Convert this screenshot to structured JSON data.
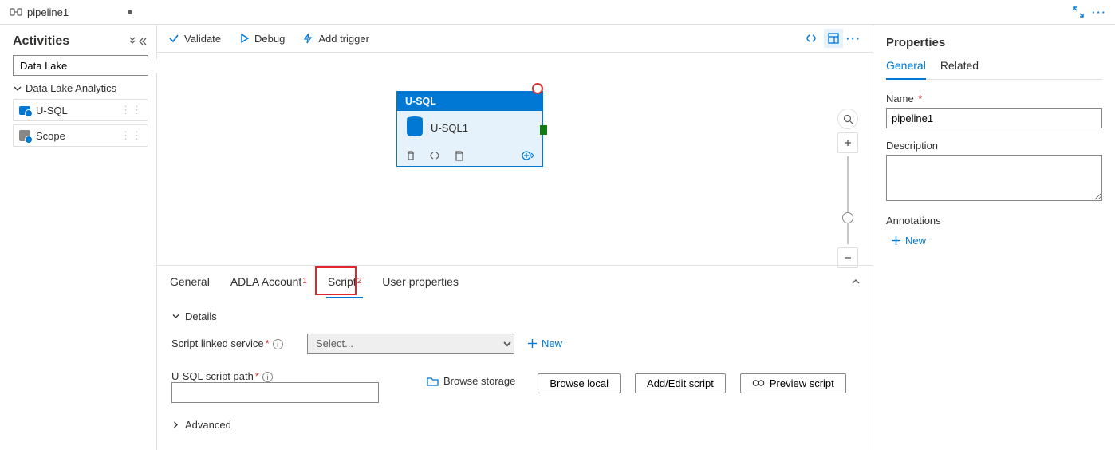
{
  "tab": {
    "name": "pipeline1"
  },
  "activities": {
    "title": "Activities",
    "search_placeholder": "Data Lake",
    "group": "Data Lake Analytics",
    "items": [
      {
        "label": "U-SQL"
      },
      {
        "label": "Scope"
      }
    ]
  },
  "toolbar": {
    "validate": "Validate",
    "debug": "Debug",
    "add_trigger": "Add trigger"
  },
  "canvas": {
    "node_type": "U-SQL",
    "node_name": "U-SQL1"
  },
  "bottom": {
    "tabs": {
      "general": "General",
      "adla": "ADLA Account",
      "script": "Script",
      "user_props": "User properties"
    },
    "details": "Details",
    "linked_service_label": "Script linked service",
    "linked_service_placeholder": "Select...",
    "new_label": "New",
    "script_path_label": "U-SQL script path",
    "browse_storage": "Browse storage",
    "browse_local": "Browse local",
    "add_edit_script": "Add/Edit script",
    "preview_script": "Preview script",
    "advanced": "Advanced"
  },
  "properties": {
    "title": "Properties",
    "tab_general": "General",
    "tab_related": "Related",
    "name_label": "Name",
    "name_value": "pipeline1",
    "desc_label": "Description",
    "annotations_label": "Annotations",
    "new_label": "New"
  },
  "callouts": {
    "adla_badge": "1",
    "script_badge": "2"
  }
}
